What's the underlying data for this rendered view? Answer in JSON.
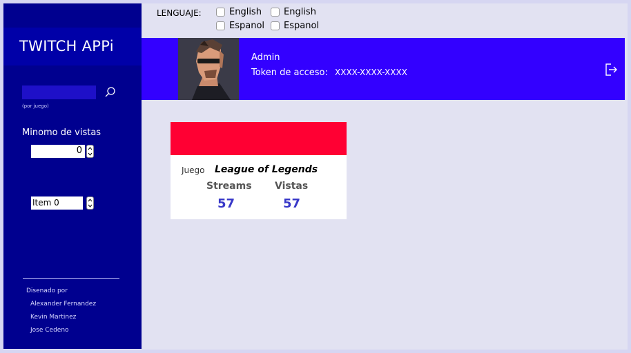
{
  "app": {
    "title": "TWITCH APPi"
  },
  "sidebar": {
    "search_hint": "(por juego)",
    "search_value": "",
    "min_views_label": "Minomo de vistas",
    "min_views_value": "0",
    "item_select_value": "Item 0",
    "credits": {
      "heading": "Disenado por",
      "names": [
        "Alexander Fernandez",
        "Kevin Martinez",
        "Jose Cedeno"
      ]
    }
  },
  "language": {
    "label": "LENGUAJE:",
    "options": [
      {
        "label": "English",
        "checked": false
      },
      {
        "label": "English",
        "checked": false
      },
      {
        "label": "Espanol",
        "checked": false
      },
      {
        "label": "Espanol",
        "checked": false
      }
    ]
  },
  "header": {
    "user": "Admin",
    "token_label": "Token de acceso:",
    "token_value": "XXXX-XXXX-XXXX",
    "logout_icon": "logout-icon"
  },
  "card": {
    "game_label": "Juego",
    "game_name": "League of Legends",
    "streams_label": "Streams",
    "vistas_label": "Vistas",
    "streams_value": "57",
    "vistas_value": "57",
    "banner_color": "#ff0033"
  },
  "colors": {
    "sidebar": "#00008f",
    "header": "#3300ff",
    "accent_number": "#3838c8"
  }
}
